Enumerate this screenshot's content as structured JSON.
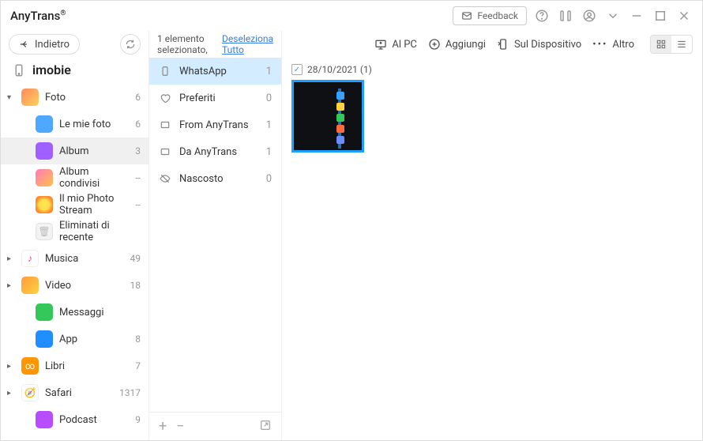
{
  "app_title": "AnyTrans",
  "feedback": "Feedback",
  "back": "Indietro",
  "device": "imobie",
  "sidebar": [
    {
      "label": "Foto",
      "count": "6",
      "caret": "▾",
      "cls": "ic-flower",
      "indent": false,
      "active": false,
      "glyph": ""
    },
    {
      "label": "Le mie foto",
      "count": "6",
      "caret": "",
      "cls": "ic-photos",
      "indent": true,
      "active": false,
      "glyph": ""
    },
    {
      "label": "Album",
      "count": "3",
      "caret": "",
      "cls": "ic-album",
      "indent": true,
      "active": true,
      "glyph": ""
    },
    {
      "label": "Album condivisi",
      "count": "--",
      "caret": "",
      "cls": "ic-shared",
      "indent": true,
      "active": false,
      "glyph": ""
    },
    {
      "label": "Il mio Photo Stream",
      "count": "--",
      "caret": "",
      "cls": "ic-sun",
      "indent": true,
      "active": false,
      "glyph": ""
    },
    {
      "label": "Eliminati di recente",
      "count": "",
      "caret": "",
      "cls": "ic-trash",
      "indent": true,
      "active": false,
      "glyph": "🗑"
    },
    {
      "label": "Musica",
      "count": "49",
      "caret": "▸",
      "cls": "ic-music",
      "indent": false,
      "active": false,
      "glyph": "♪"
    },
    {
      "label": "Video",
      "count": "18",
      "caret": "▸",
      "cls": "ic-video",
      "indent": false,
      "active": false,
      "glyph": ""
    },
    {
      "label": "Messaggi",
      "count": "",
      "caret": "",
      "cls": "ic-msg",
      "indent": true,
      "active": false,
      "glyph": ""
    },
    {
      "label": "App",
      "count": "8",
      "caret": "",
      "cls": "ic-app",
      "indent": true,
      "active": false,
      "glyph": ""
    },
    {
      "label": "Libri",
      "count": "7",
      "caret": "▸",
      "cls": "ic-books",
      "indent": false,
      "active": false,
      "glyph": "∞"
    },
    {
      "label": "Safari",
      "count": "1317",
      "caret": "▸",
      "cls": "ic-safari",
      "indent": false,
      "active": false,
      "glyph": "🧭"
    },
    {
      "label": "Podcast",
      "count": "9",
      "caret": "",
      "cls": "ic-podcast",
      "indent": true,
      "active": false,
      "glyph": ""
    }
  ],
  "selection_prefix": "1 elemento selezionato,",
  "deselect": "Deseleziona Tutto",
  "albums": [
    {
      "label": "WhatsApp",
      "count": "1",
      "selected": true,
      "icon": "phone"
    },
    {
      "label": "Preferiti",
      "count": "0",
      "selected": false,
      "icon": "heart"
    },
    {
      "label": "From AnyTrans",
      "count": "1",
      "selected": false,
      "icon": "folder"
    },
    {
      "label": "Da AnyTrans",
      "count": "1",
      "selected": false,
      "icon": "folder"
    },
    {
      "label": "Nascosto",
      "count": "0",
      "selected": false,
      "icon": "eyeoff"
    }
  ],
  "toolbar": {
    "al_pc": "Al PC",
    "aggiungi": "Aggiungi",
    "sul_dispositivo": "Sul Dispositivo",
    "altro": "Altro"
  },
  "date_header": "28/10/2021 (1)"
}
